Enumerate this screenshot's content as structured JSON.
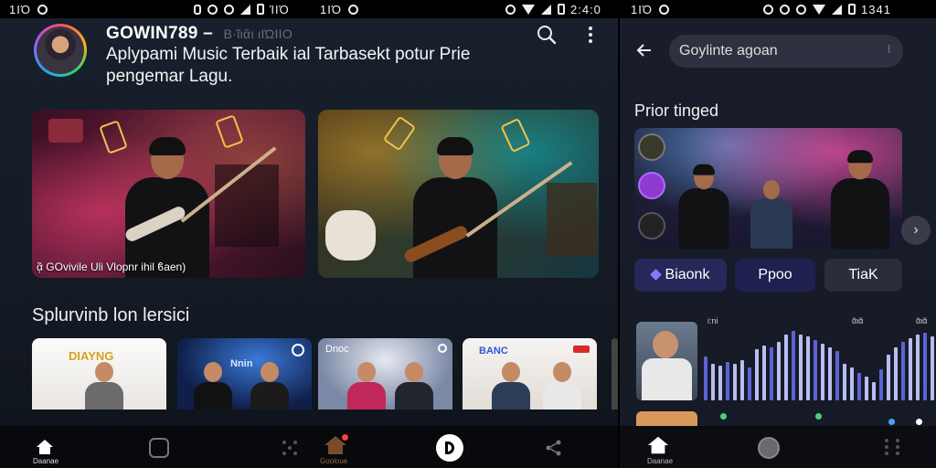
{
  "status_bars": [
    {
      "left": "1ΙΌ",
      "time": "ΊΙΌ"
    },
    {
      "left": "1ΙΌ",
      "time": "2:4:0"
    },
    {
      "left": "1ΙΌ",
      "time": "1341"
    }
  ],
  "header": {
    "title": "GOWIN789  –",
    "title_faded": "Β·ῖιᾶι ιΙΏΙΙΟ",
    "subtitle": "Aplypami Music Terbaik ial Tarbasekt potur Prie pengemar Lagu."
  },
  "featured_cards": [
    {
      "caption": "ᾷ GOvivile Uli Vlopnr ihil ϐaen)"
    },
    {
      "caption": ""
    }
  ],
  "section_title": "Splurvinb lon lersici",
  "thumbnails": [
    {
      "label": "DIAYNG"
    },
    {
      "label": "Nnin"
    },
    {
      "label": "Dnoc"
    },
    {
      "label": "BANC"
    }
  ],
  "bottom_nav_left": {
    "home_label": "Daanae",
    "center_label": "Gooloue"
  },
  "right_screen": {
    "search_value": "Goylinte agoan",
    "search_mic": "⦙",
    "section_title": "Prior tinged",
    "chips": [
      "Biaonk",
      "Ρpoo",
      "TiaK"
    ],
    "viz_labels": [
      "i:ni",
      "ᾶιᾶ",
      "ᾶιᾶ"
    ],
    "nav_home_label": "Daanae"
  },
  "colors": {
    "accent_purple": "#7d7cff",
    "chip_active": "#26285a",
    "bar_blue": "#5b63d6",
    "bar_light": "#b9bdf0"
  }
}
